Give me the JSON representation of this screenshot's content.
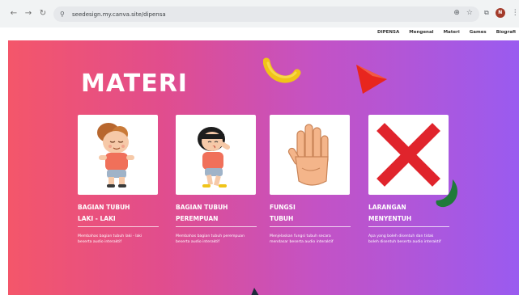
{
  "browser": {
    "back_icon": "←",
    "forward_icon": "→",
    "reload_icon": "↻",
    "site_info_icon": "⚲",
    "url": "seedesign.my.canva.site/dipensa",
    "zoom_icon": "⊕",
    "star_icon": "☆",
    "extensions_icon": "⧉",
    "avatar_letter": "N",
    "more_icon": "⋮"
  },
  "site_nav": {
    "items": [
      "DIPENSA",
      "Mengenal",
      "Materi",
      "Games",
      "Biografi"
    ]
  },
  "hero": {
    "title": "MATERI"
  },
  "cards": [
    {
      "title_line1": "BAGIAN TUBUH",
      "title_line2": "LAKI - LAKI",
      "desc": "Membahas bagian tubuh laki - laki beserta audio interaktif"
    },
    {
      "title_line1": "BAGIAN TUBUH",
      "title_line2": "PEREMPUAN",
      "desc": "Membahas bagian tubuh perempuan beserta audio interaktif"
    },
    {
      "title_line1": "FUNGSI",
      "title_line2": "TUBUH",
      "desc": "Menjelaskan fungsi tubuh secara mendasar beserta audio interaktif"
    },
    {
      "title_line1": "LARANGAN",
      "title_line2": "MENYENTUH",
      "desc": "Apa yang boleh disentuh dan tidak boleh disentuh beserta audio interaktif"
    }
  ],
  "colors": {
    "gradient_start": "#f4566a",
    "gradient_end": "#9a5bf0",
    "x_mark": "#e0242c"
  }
}
